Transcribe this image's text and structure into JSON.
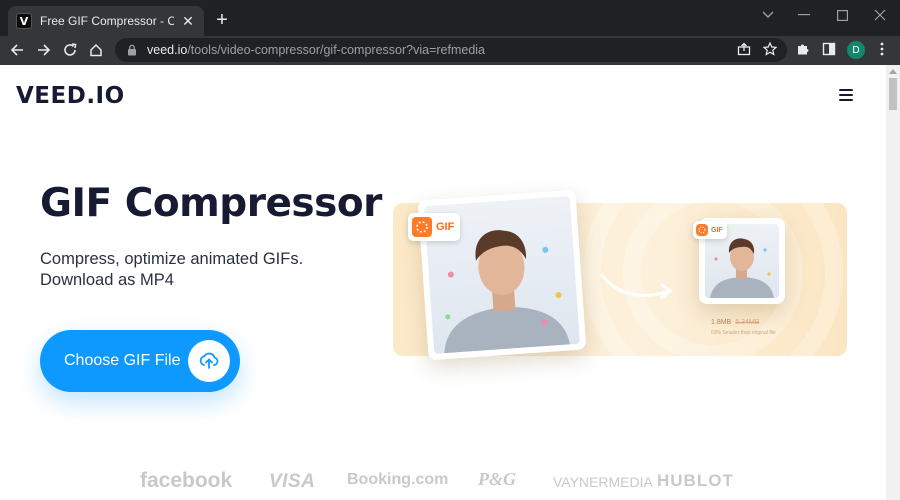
{
  "browser": {
    "tab": {
      "favicon": "V",
      "title": "Free GIF Compressor - Compress",
      "close": "✕"
    },
    "new_tab": "+",
    "url": {
      "host": "veed.io",
      "path": "/tools/video-compressor/gif-compressor?via=refmedia"
    },
    "profile_initial": "D",
    "icons": [
      "back-icon",
      "forward-icon",
      "reload-icon",
      "home-icon",
      "lock-icon",
      "share-icon",
      "star-icon",
      "extensions-icon",
      "sidebar-icon",
      "profile-avatar",
      "kebab-menu-icon",
      "minimize-icon",
      "maximize-icon",
      "close-window-icon"
    ]
  },
  "site": {
    "logo": "VEED.IO",
    "title": "GIF Compressor",
    "subtitle": "Compress, optimize animated GIFs. Download as MP4",
    "cta_label": "Choose GIF File",
    "illustration": {
      "badge_big": "GIF",
      "badge_small": "GIF",
      "size_new": "1.8MB",
      "size_old": "5.34MB",
      "note": "63% Smaller than original file"
    },
    "brands": [
      "facebook",
      "VISA",
      "Booking.com",
      "P&G",
      "VAYNERMEDIA",
      "HUBLOT"
    ]
  },
  "colors": {
    "accent": "#0d99ff",
    "brand_dark": "#161b33",
    "gif_orange": "#ff7a29"
  }
}
